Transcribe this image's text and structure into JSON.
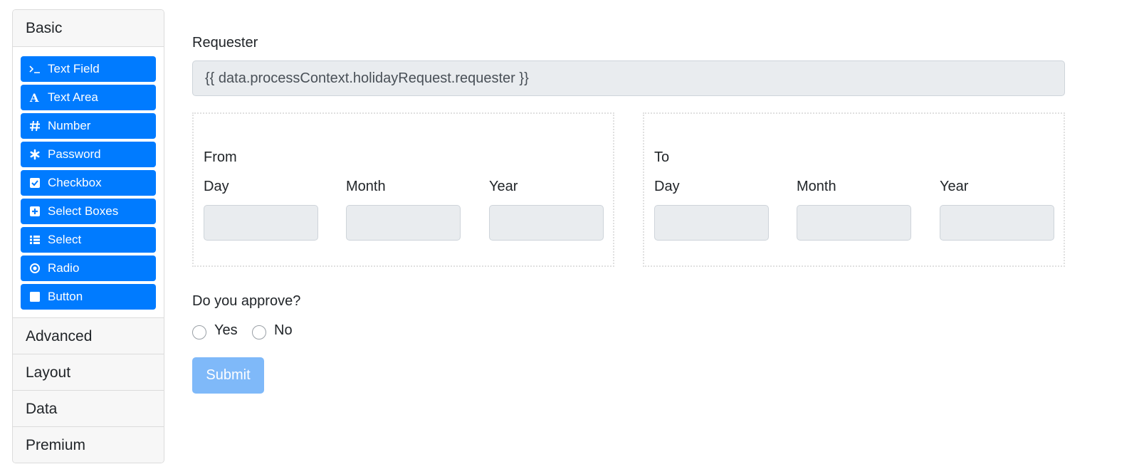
{
  "sidebar": {
    "groups": {
      "basic": "Basic",
      "advanced": "Advanced",
      "layout": "Layout",
      "data": "Data",
      "premium": "Premium"
    },
    "components": [
      {
        "label": "Text Field",
        "icon": "terminal-icon"
      },
      {
        "label": "Text Area",
        "icon": "font-icon"
      },
      {
        "label": "Number",
        "icon": "hash-icon"
      },
      {
        "label": "Password",
        "icon": "asterisk-icon"
      },
      {
        "label": "Checkbox",
        "icon": "check-square-icon"
      },
      {
        "label": "Select Boxes",
        "icon": "plus-square-icon"
      },
      {
        "label": "Select",
        "icon": "list-icon"
      },
      {
        "label": "Radio",
        "icon": "dot-circle-icon"
      },
      {
        "label": "Button",
        "icon": "stop-icon"
      }
    ]
  },
  "form": {
    "requester_label": "Requester",
    "requester_value": "{{ data.processContext.holidayRequest.requester }}",
    "from": {
      "title": "From",
      "day": "Day",
      "month": "Month",
      "year": "Year"
    },
    "to": {
      "title": "To",
      "day": "Day",
      "month": "Month",
      "year": "Year"
    },
    "approve_label": "Do you approve?",
    "options": {
      "yes": "Yes",
      "no": "No"
    },
    "submit_label": "Submit"
  },
  "colors": {
    "primary": "#007bff",
    "submit_disabled": "#7fb9f9",
    "input_bg": "#e9ecef"
  }
}
